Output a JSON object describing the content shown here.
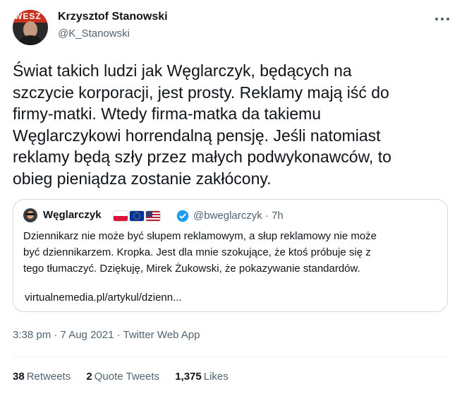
{
  "author": {
    "name": "Krzysztof Stanowski",
    "handle": "@K_Stanowski",
    "avatar_band_text": "WESZ"
  },
  "tweet": {
    "text": "Świat takich ludzi jak Węglarczyk, będących na\nszczycie korporacji, jest prosty. Reklamy mają iść do\nfirmy-matki. Wtedy firma-matka da takiemu\nWęglarczykowi horrendalną pensję. Jeśli natomiast\nreklamy będą szły przez małych podwykonawców, to\nobieg pieniądza zostanie zakłócony.",
    "timestamp": "3:38 pm · 7 Aug 2021 · Twitter Web App"
  },
  "quote": {
    "name": "Węglarczyk",
    "flags": [
      "poland-flag",
      "eu-flag",
      "us-flag"
    ],
    "verified": true,
    "meta": "@bweglarczyk · 7h",
    "text": "Dziennikarz nie może być słupem reklamowym, a słup reklamowy nie może\nbyć dziennikarzem. Kropka. Jest dla mnie szokujące, że ktoś próbuje się z\ntego tłumaczyć. Dziękuję, Mirek Żukowski, że pokazywanie standardów.",
    "link": "virtualnemedia.pl/artykul/dzienn..."
  },
  "stats": {
    "retweets_count": "38",
    "retweets_label": "Retweets",
    "quotes_count": "2",
    "quotes_label": "Quote Tweets",
    "likes_count": "1,375",
    "likes_label": "Likes"
  },
  "colors": {
    "text": "#0f1419",
    "secondary": "#536471",
    "border": "#cfd9de",
    "verified": "#1d9bf0"
  }
}
